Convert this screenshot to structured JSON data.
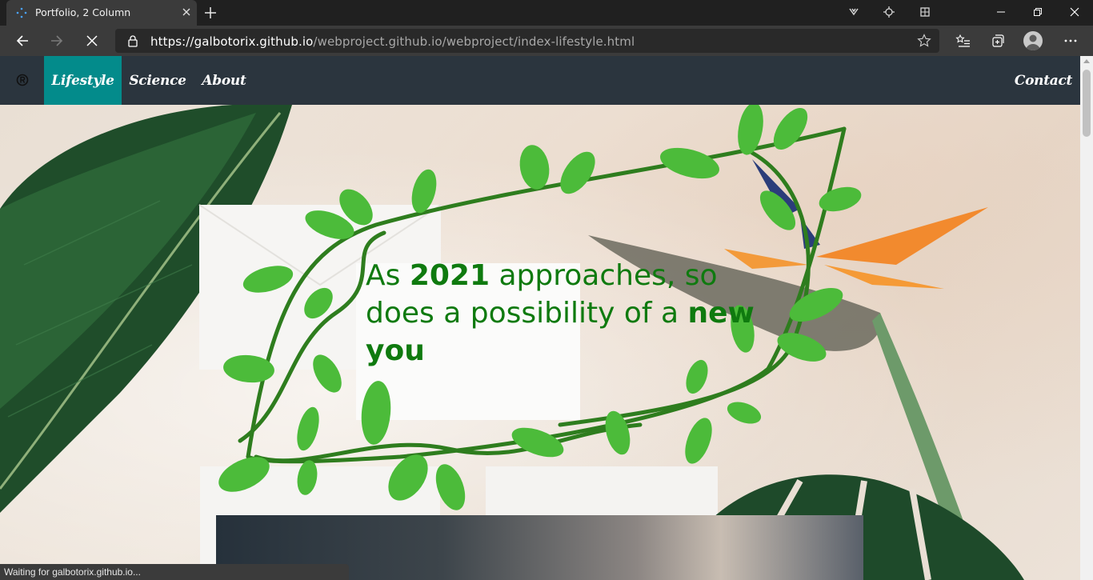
{
  "browser": {
    "tab_title": "Portfolio, 2 Column",
    "url_scheme": "https://",
    "url_host": "galbotorix.github.io",
    "url_path": "/webproject.github.io/webproject/index-lifestyle.html",
    "status_text": "Waiting for galbotorix.github.io..."
  },
  "nav": {
    "logo_icon": "registered-icon",
    "items": [
      {
        "label": "Lifestyle",
        "active": true
      },
      {
        "label": "Science",
        "active": false
      },
      {
        "label": "About",
        "active": false
      }
    ],
    "contact_label": "Contact"
  },
  "hero": {
    "headline_1": "As ",
    "headline_year": "2021",
    "headline_2": " approaches, so does a possibility of a ",
    "headline_bold": "new you"
  },
  "colors": {
    "nav_bg": "#2b353e",
    "nav_active": "#038b8b",
    "headline": "#0f7a0f",
    "vine": "#2e7d1e",
    "leaf": "#4cbb3a"
  }
}
